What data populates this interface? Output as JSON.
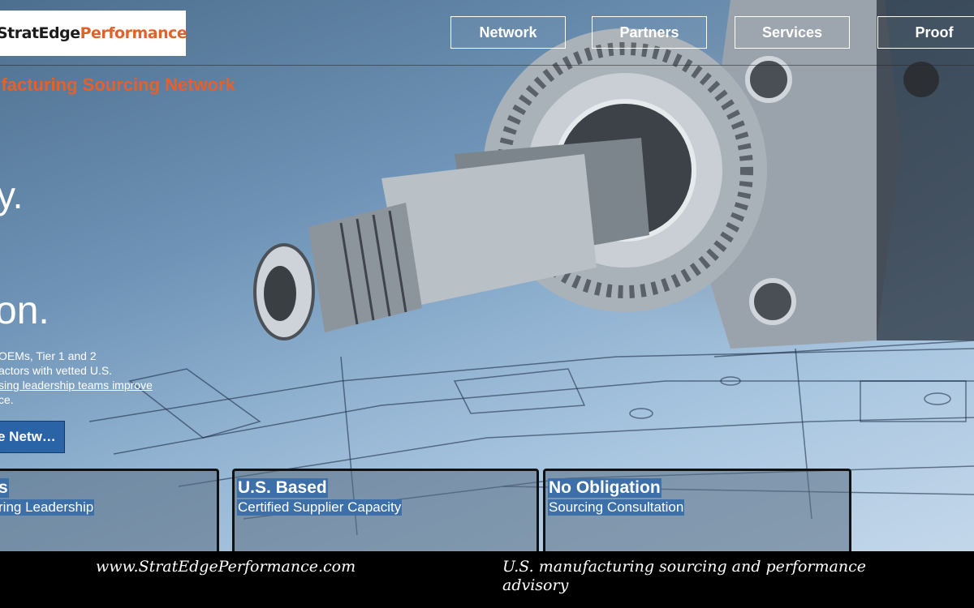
{
  "header": {
    "logo": {
      "part1": "StratEdge",
      "part2": "Performance",
      "color1": "#1b1b1b",
      "color2": "#e0622b"
    },
    "nav": [
      {
        "label": "Network"
      },
      {
        "label": "Partners"
      },
      {
        "label": "Services"
      },
      {
        "label": "Proof"
      }
    ]
  },
  "hero": {
    "tagline": "ufacturing Sourcing Network",
    "headline_line1": "y.",
    "headline_line2": "on.",
    "body_lines": [
      "OEMs, Tier 1 and 2",
      "actors with vetted U.S.",
      "sing leadership teams improve",
      "ce."
    ],
    "cta_label": "e Netw…",
    "accent_color": "#e85f2a"
  },
  "cards": [
    {
      "title": "s",
      "subtitle": "ring Leadership",
      "extra": ""
    },
    {
      "title": "U.S. Based",
      "subtitle": "Certified Supplier Capacity"
    },
    {
      "title": "No Obligation",
      "subtitle": "Sourcing Consultation"
    }
  ],
  "footer": {
    "website": "www.StratEdgePerformance.com",
    "description": "U.S. manufacturing sourcing and performance advisory"
  }
}
